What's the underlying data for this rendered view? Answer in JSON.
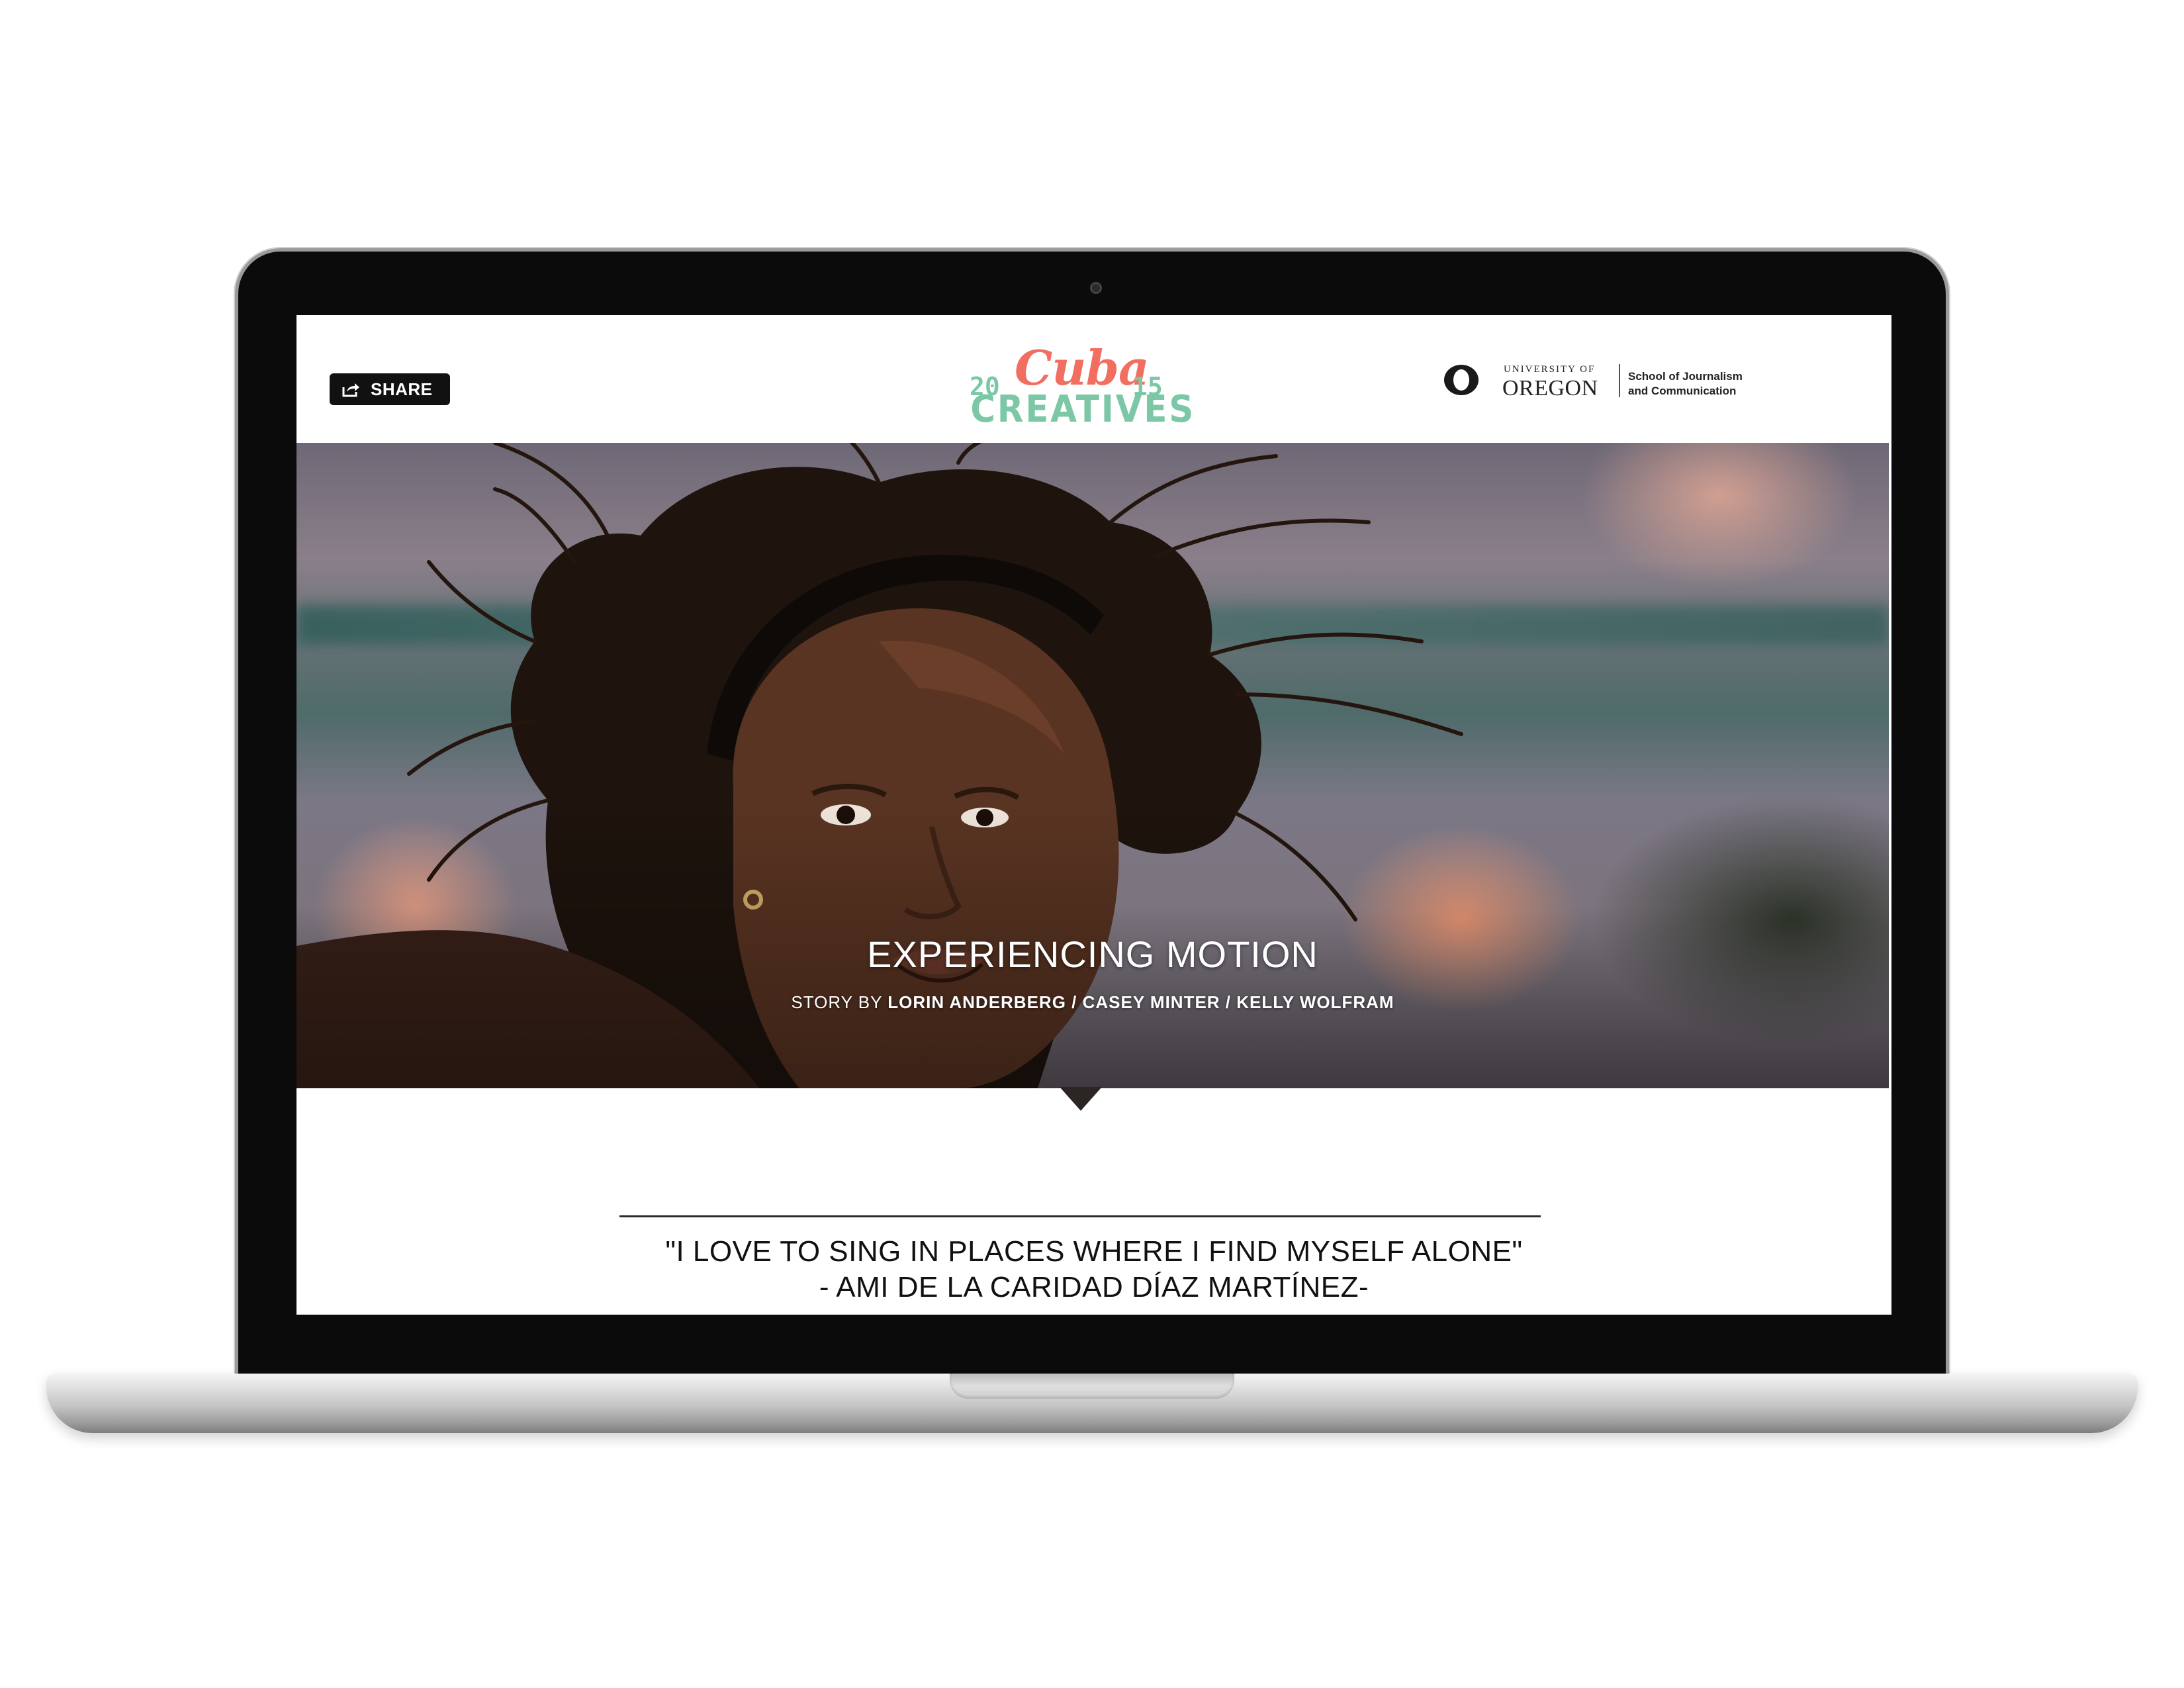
{
  "header": {
    "share_label": "SHARE",
    "logo": {
      "year_left": "20",
      "script_word": "Cuba",
      "year_right": "15",
      "word": "CREATIVES"
    },
    "university": {
      "small": "UNIVERSITY OF",
      "name": "OREGON",
      "school_line1": "School of Journalism",
      "school_line2": "and Communication"
    }
  },
  "hero": {
    "title": "EXPERIENCING MOTION",
    "byline_prefix": "STORY BY ",
    "byline_names": "LORIN ANDERBERG / CASEY MINTER / KELLY WOLFRAM"
  },
  "quote": {
    "line1": "\"I LOVE TO SING IN PLACES WHERE I FIND MYSELF ALONE\"",
    "line2": "- AMI DE LA CARIDAD DÍAZ MARTÍNEZ-"
  },
  "icons": {
    "share": "share-icon",
    "uo_logo": "uo-o-icon"
  },
  "colors": {
    "accent_coral": "#f06f61",
    "accent_mint": "#7cc7a6",
    "button_dark": "#111111"
  }
}
